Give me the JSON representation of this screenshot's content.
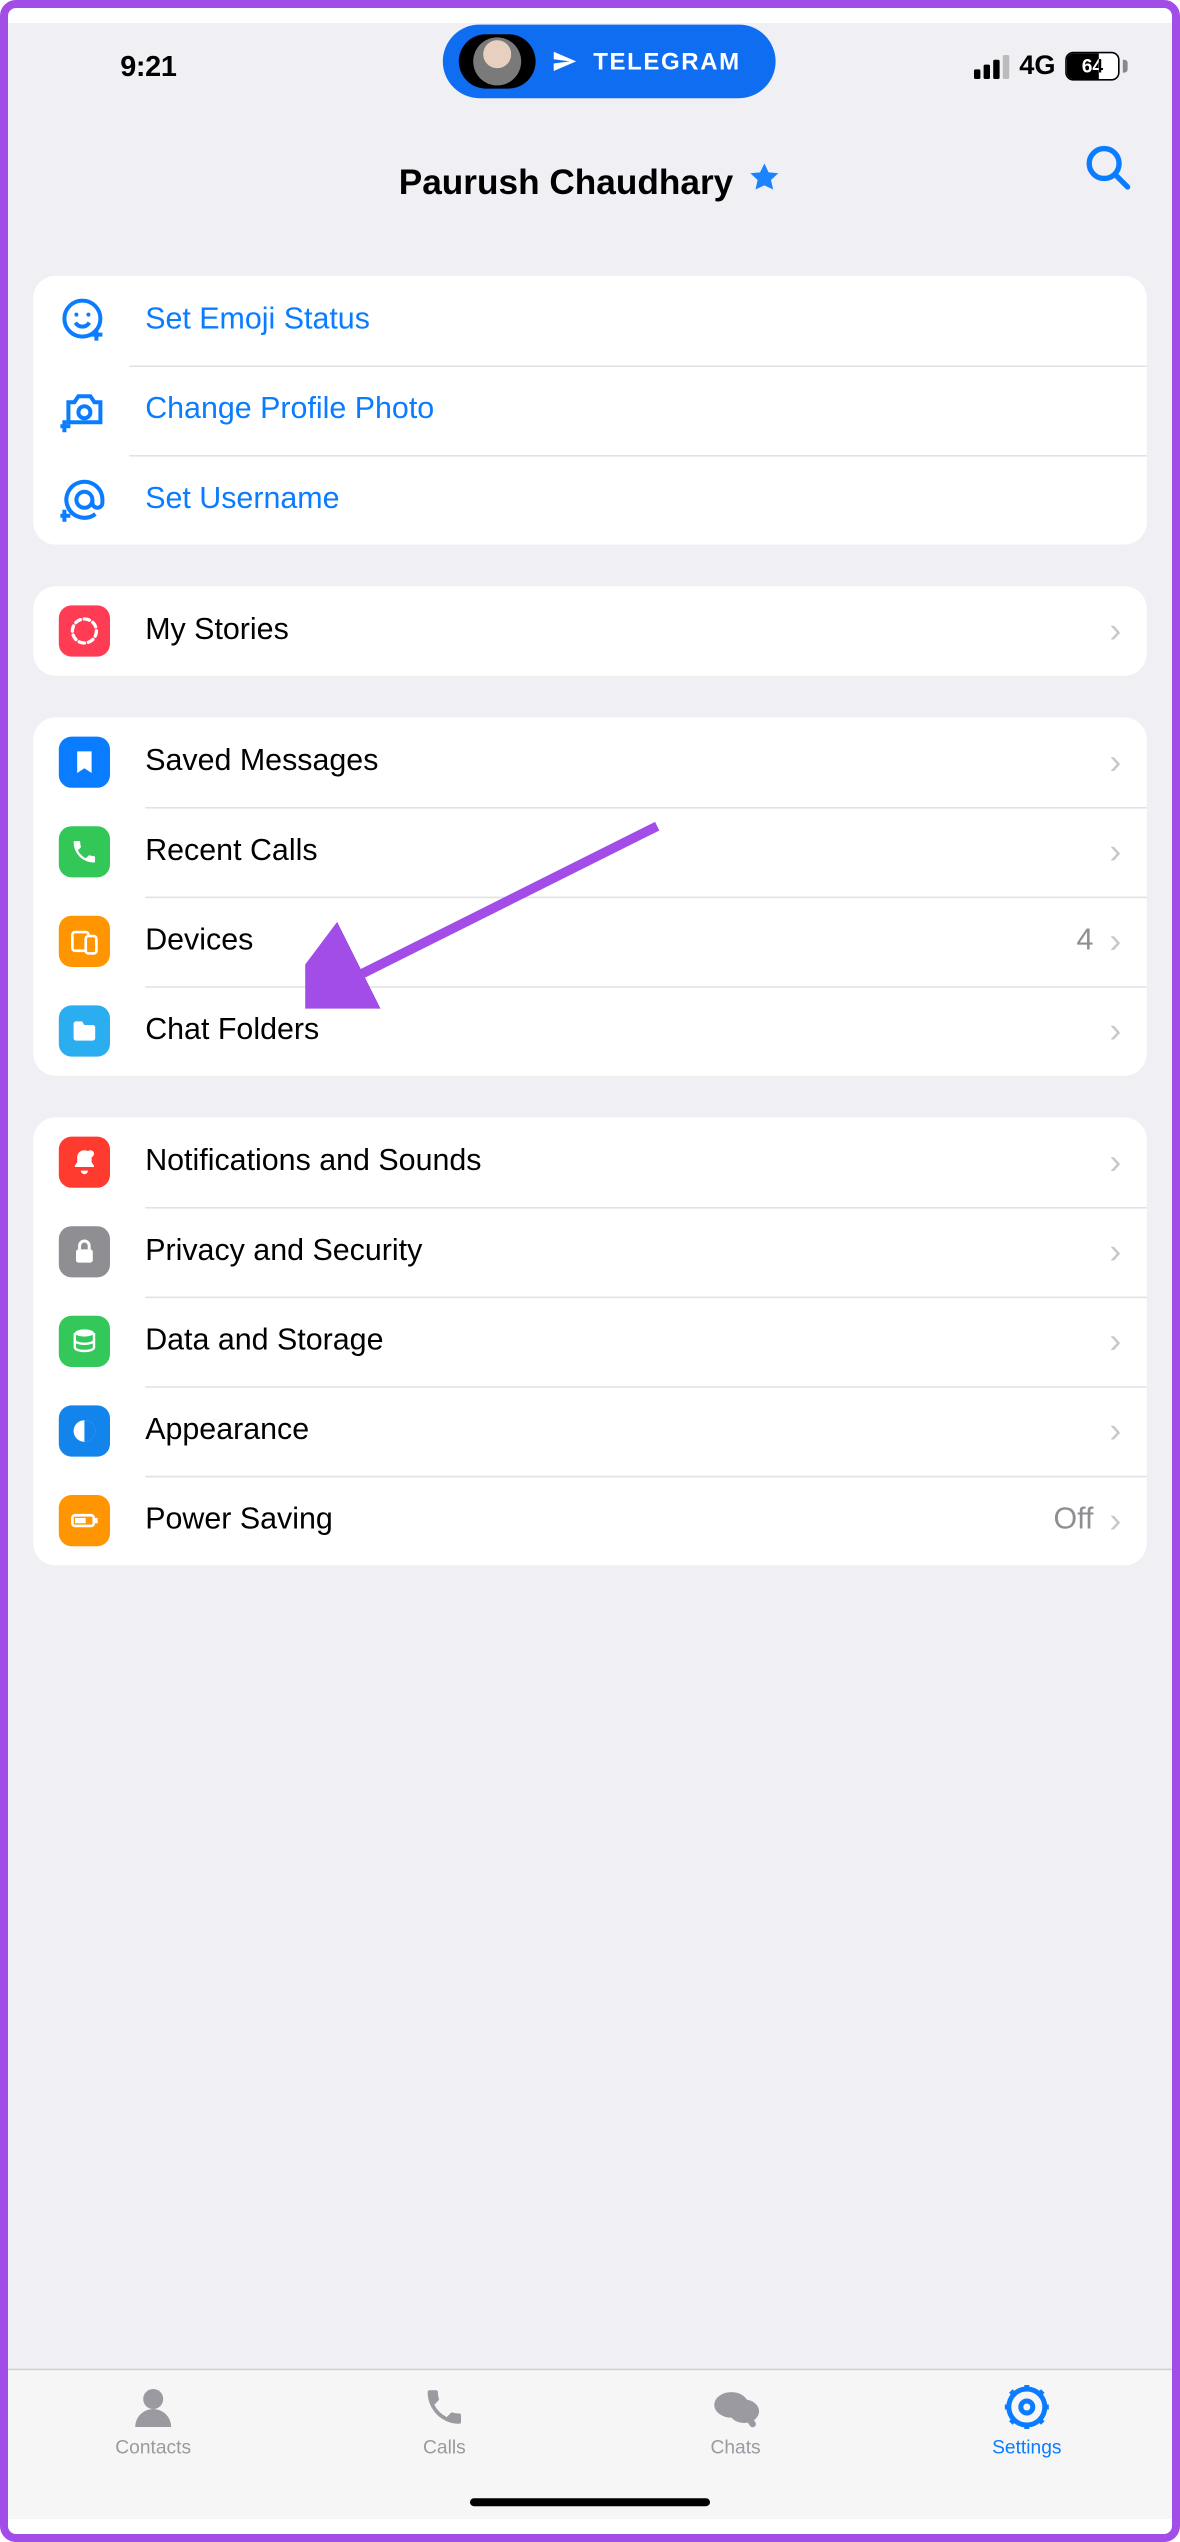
{
  "status": {
    "time": "9:21",
    "pill_label": "TELEGRAM",
    "network": "4G",
    "battery": "64"
  },
  "header": {
    "title": "Paurush Chaudhary"
  },
  "section_profile": {
    "emoji_status": "Set Emoji Status",
    "change_photo": "Change Profile Photo",
    "set_username": "Set Username"
  },
  "section_stories": {
    "my_stories": "My Stories"
  },
  "section_chats": {
    "saved_messages": "Saved Messages",
    "recent_calls": "Recent Calls",
    "devices": "Devices",
    "devices_count": "4",
    "chat_folders": "Chat Folders"
  },
  "section_settings": {
    "notifications": "Notifications and Sounds",
    "privacy": "Privacy and Security",
    "data_storage": "Data and Storage",
    "appearance": "Appearance",
    "power_saving": "Power Saving",
    "power_saving_value": "Off"
  },
  "tabs": {
    "contacts": "Contacts",
    "calls": "Calls",
    "chats": "Chats",
    "settings": "Settings"
  }
}
